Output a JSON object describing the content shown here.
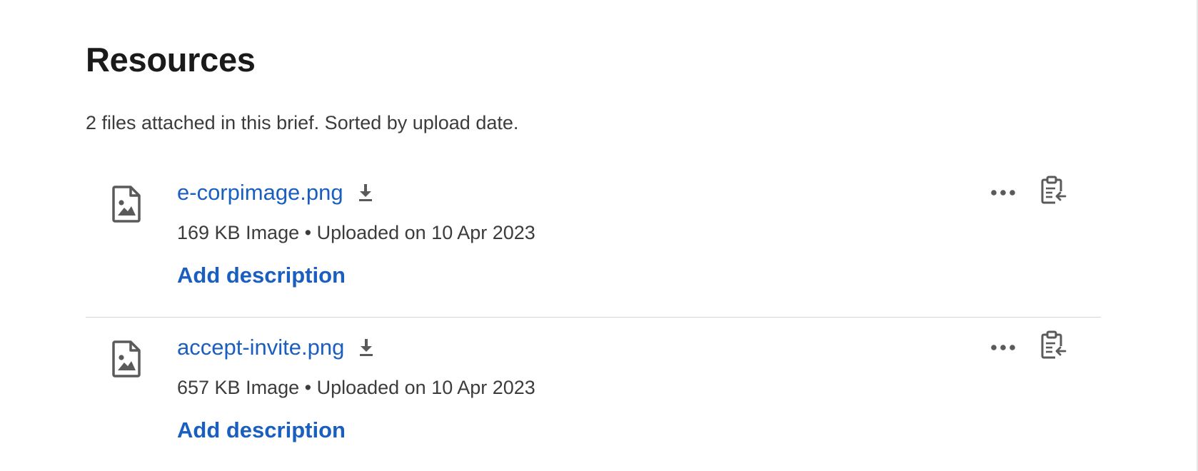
{
  "section": {
    "title": "Resources",
    "subtitle": "2 files attached in this brief. Sorted by upload date."
  },
  "files": [
    {
      "name": "e-corpimage.png",
      "meta": "169 KB Image • Uploaded on 10 Apr 2023",
      "add_description_label": "Add description",
      "icon": "image-file-icon"
    },
    {
      "name": "accept-invite.png",
      "meta": "657 KB Image • Uploaded on 10 Apr 2023",
      "add_description_label": "Add description",
      "icon": "image-file-icon"
    }
  ],
  "icons": {
    "download": "download-icon",
    "more": "more-options-icon",
    "copy": "clipboard-paste-icon"
  },
  "colors": {
    "link": "#1a5fbf",
    "text": "#3c3c3c",
    "heading": "#1a1a1a",
    "icon": "#5a5a5a",
    "divider": "#d5d5d5"
  }
}
